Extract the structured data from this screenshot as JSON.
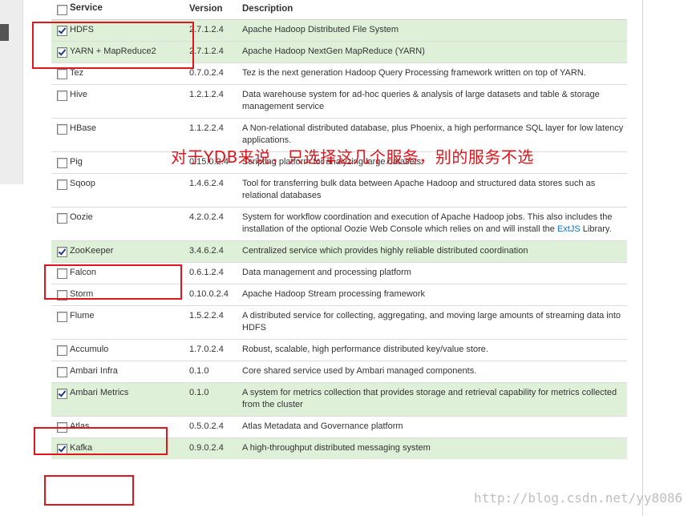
{
  "table": {
    "headers": {
      "service": "Service",
      "version": "Version",
      "description": "Description"
    },
    "rows": [
      {
        "name": "HDFS",
        "version": "2.7.1.2.4",
        "description": "Apache Hadoop Distributed File System",
        "checked": true
      },
      {
        "name": "YARN + MapReduce2",
        "version": "2.7.1.2.4",
        "description": "Apache Hadoop NextGen MapReduce (YARN)",
        "checked": true
      },
      {
        "name": "Tez",
        "version": "0.7.0.2.4",
        "description": "Tez is the next generation Hadoop Query Processing framework written on top of YARN.",
        "checked": false
      },
      {
        "name": "Hive",
        "version": "1.2.1.2.4",
        "description": "Data warehouse system for ad-hoc queries & analysis of large datasets and table & storage management service",
        "checked": false
      },
      {
        "name": "HBase",
        "version": "1.1.2.2.4",
        "description": "A Non-relational distributed database, plus Phoenix, a high performance SQL layer for low latency applications.",
        "checked": false
      },
      {
        "name": "Pig",
        "version": "0.15.0.2.4",
        "description": "Scripting platform for analyzing large datasets",
        "checked": false
      },
      {
        "name": "Sqoop",
        "version": "1.4.6.2.4",
        "description": "Tool for transferring bulk data between Apache Hadoop and structured data stores such as relational databases",
        "checked": false
      },
      {
        "name": "Oozie",
        "version": "4.2.0.2.4",
        "description": "System for workflow coordination and execution of Apache Hadoop jobs. This also includes the installation of the optional Oozie Web Console which relies on and will install the",
        "link": "ExtJS",
        "description_suffix": " Library.",
        "checked": false
      },
      {
        "name": "ZooKeeper",
        "version": "3.4.6.2.4",
        "description": "Centralized service which provides highly reliable distributed coordination",
        "checked": true
      },
      {
        "name": "Falcon",
        "version": "0.6.1.2.4",
        "description": "Data management and processing platform",
        "checked": false
      },
      {
        "name": "Storm",
        "version": "0.10.0.2.4",
        "description": "Apache Hadoop Stream processing framework",
        "checked": false
      },
      {
        "name": "Flume",
        "version": "1.5.2.2.4",
        "description": "A distributed service for collecting, aggregating, and moving large amounts of streaming data into HDFS",
        "checked": false
      },
      {
        "name": "Accumulo",
        "version": "1.7.0.2.4",
        "description": "Robust, scalable, high performance distributed key/value store.",
        "checked": false
      },
      {
        "name": "Ambari Infra",
        "version": "0.1.0",
        "description": "Core shared service used by Ambari managed components.",
        "checked": false
      },
      {
        "name": "Ambari Metrics",
        "version": "0.1.0",
        "description": "A system for metrics collection that provides storage and retrieval capability for metrics collected from the cluster",
        "checked": true
      },
      {
        "name": "Atlas",
        "version": "0.5.0.2.4",
        "description": "Atlas Metadata and Governance platform",
        "checked": false
      },
      {
        "name": "Kafka",
        "version": "0.9.0.2.4",
        "description": "A high-throughput distributed messaging system",
        "checked": true
      }
    ]
  },
  "annotation": "对于YDB来说，只选择这几个服务，别的服务不选",
  "watermark": "http://blog.csdn.net/yy8086",
  "colors": {
    "selected_row": "#dff0d8",
    "annotation_red": "#e0161c",
    "link": "#0572ce"
  }
}
